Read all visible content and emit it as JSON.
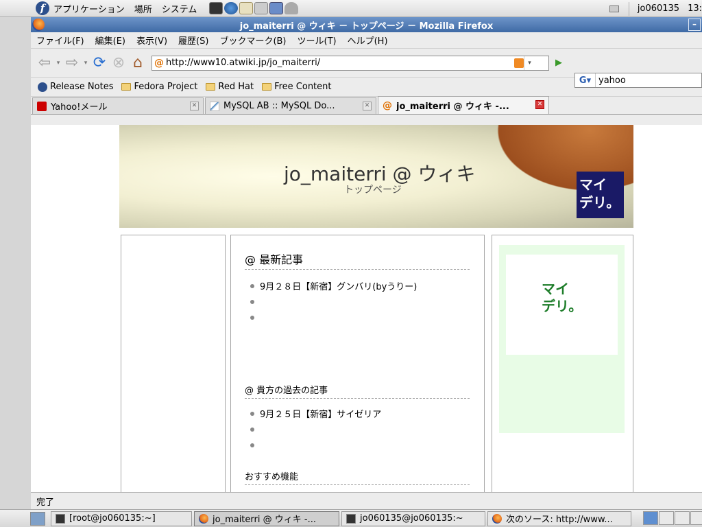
{
  "top_panel": {
    "menus": [
      "アプリケーション",
      "場所",
      "システム"
    ],
    "user": "jo060135",
    "clock": "13:"
  },
  "window": {
    "title": "jo_maiterri @ ウィキ － トップページ － Mozilla Firefox",
    "minimize_label": "–"
  },
  "menubar": [
    "ファイル(F)",
    "編集(E)",
    "表示(V)",
    "履歴(S)",
    "ブックマーク(B)",
    "ツール(T)",
    "ヘルプ(H)"
  ],
  "navbar": {
    "url": "http://www10.atwiki.jp/jo_maiterri/",
    "search_value": "yahoo",
    "search_engine_letter": "G"
  },
  "bookmarks": [
    "Release Notes",
    "Fedora Project",
    "Red Hat",
    "Free Content"
  ],
  "tabs": [
    {
      "label": "Yahoo!メール",
      "active": false
    },
    {
      "label": "MySQL AB :: MySQL Do...",
      "active": false
    },
    {
      "label": "jo_maiterri @ ウィキ -...",
      "active": true
    }
  ],
  "page": {
    "site_title": "jo_maiterri  @  ウィキ",
    "site_subtitle": "トップページ",
    "logo_line1": "マイ",
    "logo_line2": "デリ。",
    "recent_title": "@ 最新記事",
    "recent_articles": [
      "9月２８日【新宿】グンバリ(byうりー)",
      "",
      ""
    ],
    "past_title": "@ 貴方の過去の記事",
    "past_articles": [
      "9月２５日【新宿】サイゼリア",
      "",
      ""
    ],
    "recommend_title": "おすすめ機能",
    "side_logo_line1": "マイ",
    "side_logo_line2": "デリ。"
  },
  "status": "完了",
  "taskbar": [
    {
      "label": "[root@jo060135:~]",
      "icon": "terminal-icon",
      "active": false
    },
    {
      "label": "jo_maiterri @ ウィキ -...",
      "icon": "firefox-icon",
      "active": true
    },
    {
      "label": "jo060135@jo060135:~",
      "icon": "terminal-icon",
      "active": false
    },
    {
      "label": "次のソース: http://www...",
      "icon": "firefox-icon",
      "active": false
    }
  ]
}
